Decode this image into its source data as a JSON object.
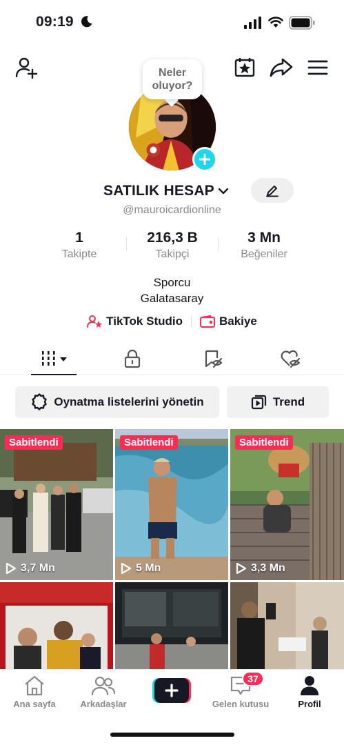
{
  "status_bar": {
    "time": "09:19"
  },
  "profile": {
    "bubble_line1": "Neler",
    "bubble_line2": "oluyor?",
    "display_name": "SATILIK HESAP",
    "username": "@mauroicardionline",
    "stats": [
      {
        "value": "1",
        "label": "Takipte"
      },
      {
        "value": "216,3 B",
        "label": "Takipçi"
      },
      {
        "value": "3 Mn",
        "label": "Beğeniler"
      }
    ],
    "bio_line1": "Sporcu",
    "bio_line2": "Galatasaray",
    "links": {
      "studio": "TikTok Studio",
      "balance": "Bakiye"
    }
  },
  "actions": {
    "playlists": "Oynatma listelerini yönetin",
    "trend": "Trend"
  },
  "videos": [
    {
      "pinned_label": "Sabitlendi",
      "views": "3,7 Mn"
    },
    {
      "pinned_label": "Sabitlendi",
      "views": "5 Mn"
    },
    {
      "pinned_label": "Sabitlendi",
      "views": "3,3 Mn"
    },
    {
      "pinned_label": "",
      "views": ""
    },
    {
      "pinned_label": "",
      "views": ""
    },
    {
      "pinned_label": "",
      "views": ""
    }
  ],
  "nav": {
    "home": "Ana sayfa",
    "friends": "Arkadaşlar",
    "inbox": "Gelen kutusu",
    "inbox_badge": "37",
    "profile": "Profil"
  },
  "colors": {
    "accent": "#fe2c55",
    "cyan": "#20d5ec",
    "text": "#161823"
  }
}
